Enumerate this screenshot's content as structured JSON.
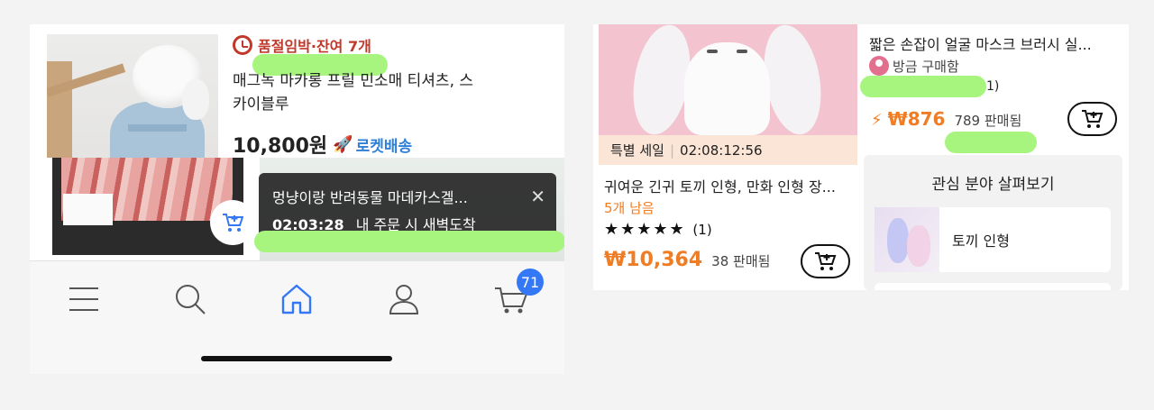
{
  "left_panel": {
    "product": {
      "alarm_text": "품절임박·잔여 7개",
      "title": "매그녹 마카롱 프릴 민소매 티셔츠, 스카이블루",
      "price": "10,800원",
      "delivery": "로켓배송"
    },
    "toast": {
      "title": "멍냥이랑 반려동물 마데카스겔...",
      "timer": "02:03:28",
      "message": "내 주문 시 새벽도착"
    },
    "navbar": {
      "items": [
        "menu-icon",
        "search-icon",
        "home-icon",
        "profile-icon",
        "cart-icon"
      ],
      "cart_badge": "71",
      "active_color": "#3478f6"
    }
  },
  "right_panel": {
    "left_product": {
      "sale_label": "특별 세일",
      "sale_timer": "02:08:12:56",
      "title": "귀여운 긴귀 토끼 인형, 만화 인형 장...",
      "stock_left": "5개 남음",
      "stars": "★★★★★",
      "rating_count": "(1)",
      "price": "₩10,364",
      "sold": "38 판매됨"
    },
    "right_product": {
      "title": "짧은 손잡이 얼굴 마스크 브러시 실...",
      "buyer_text": "방금 구매함",
      "paren": "1)",
      "price": "₩876",
      "sold": "789 판매됨"
    },
    "interest": {
      "title": "관심 분야 살펴보기",
      "item_label": "토끼 인형"
    },
    "accent_color": "#f07c23"
  }
}
